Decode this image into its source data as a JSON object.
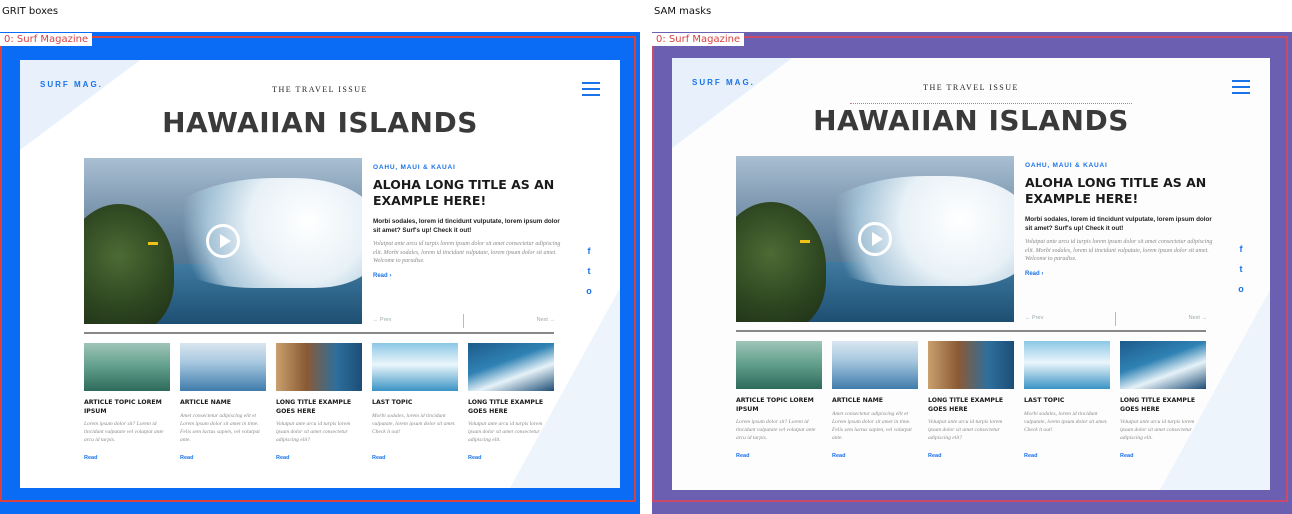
{
  "panels": {
    "left": {
      "caption": "GRIT boxes",
      "tag": "0: Surf Magazine"
    },
    "right": {
      "caption": "SAM masks",
      "tag": "0: Surf Magazine"
    }
  },
  "page": {
    "logo": "SURF MAG.",
    "issue": "THE TRAVEL ISSUE",
    "headline": "HAWAIIAN ISLANDS",
    "feature": {
      "kicker": "OAHU, MAUI & KAUAI",
      "title": "ALOHA LONG TITLE AS AN EXAMPLE HERE!",
      "lead": "Morbi sodales, lorem id tincidunt vulputate, lorem ipsum dolor sit amet? Surf's up! Check it out!",
      "body": "Volutpat ante arcu id turpis lorem ipsum dolor sit amet consectetur adipiscing elit. Morbi sodales, lorem id tincidunt vulputate, lorem ipsum dolor sit amet. Welcome to paradise.",
      "read": "Read"
    },
    "pager": {
      "prev": "Prev",
      "next": "Next"
    },
    "social": {
      "facebook": "f",
      "twitter": "t",
      "instagram": "o"
    },
    "cards": [
      {
        "title": "ARTICLE TOPIC LOREM IPSUM",
        "body": "Lorem ipsum dolor sit? Lorem id tincidunt vulputate vel volutpat ante arcu id turpis.",
        "read": "Read"
      },
      {
        "title": "ARTICLE NAME",
        "body": "Amet consectetur adipiscing elit et Lorem ipsum dolor sit amet in time. Felis sem luctus sapien, vel volutpat ante.",
        "read": "Read"
      },
      {
        "title": "LONG TITLE EXAMPLE GOES HERE",
        "body": "Volutpat ante arcu id turpis lorem ipsum dolor sit amet consectetur adipiscing elit?",
        "read": "Read"
      },
      {
        "title": "LAST TOPIC",
        "body": "Morbi sodales, lorem id tincidunt vulputate, lorem ipsum dolor sit amet. Check it out!",
        "read": "Read"
      },
      {
        "title": "LONG TITLE EXAMPLE GOES HERE",
        "body": "Volutpat ante arcu id turpis lorem ipsum dolor sit amet consectetur adipiscing elit.",
        "read": "Read"
      }
    ]
  }
}
